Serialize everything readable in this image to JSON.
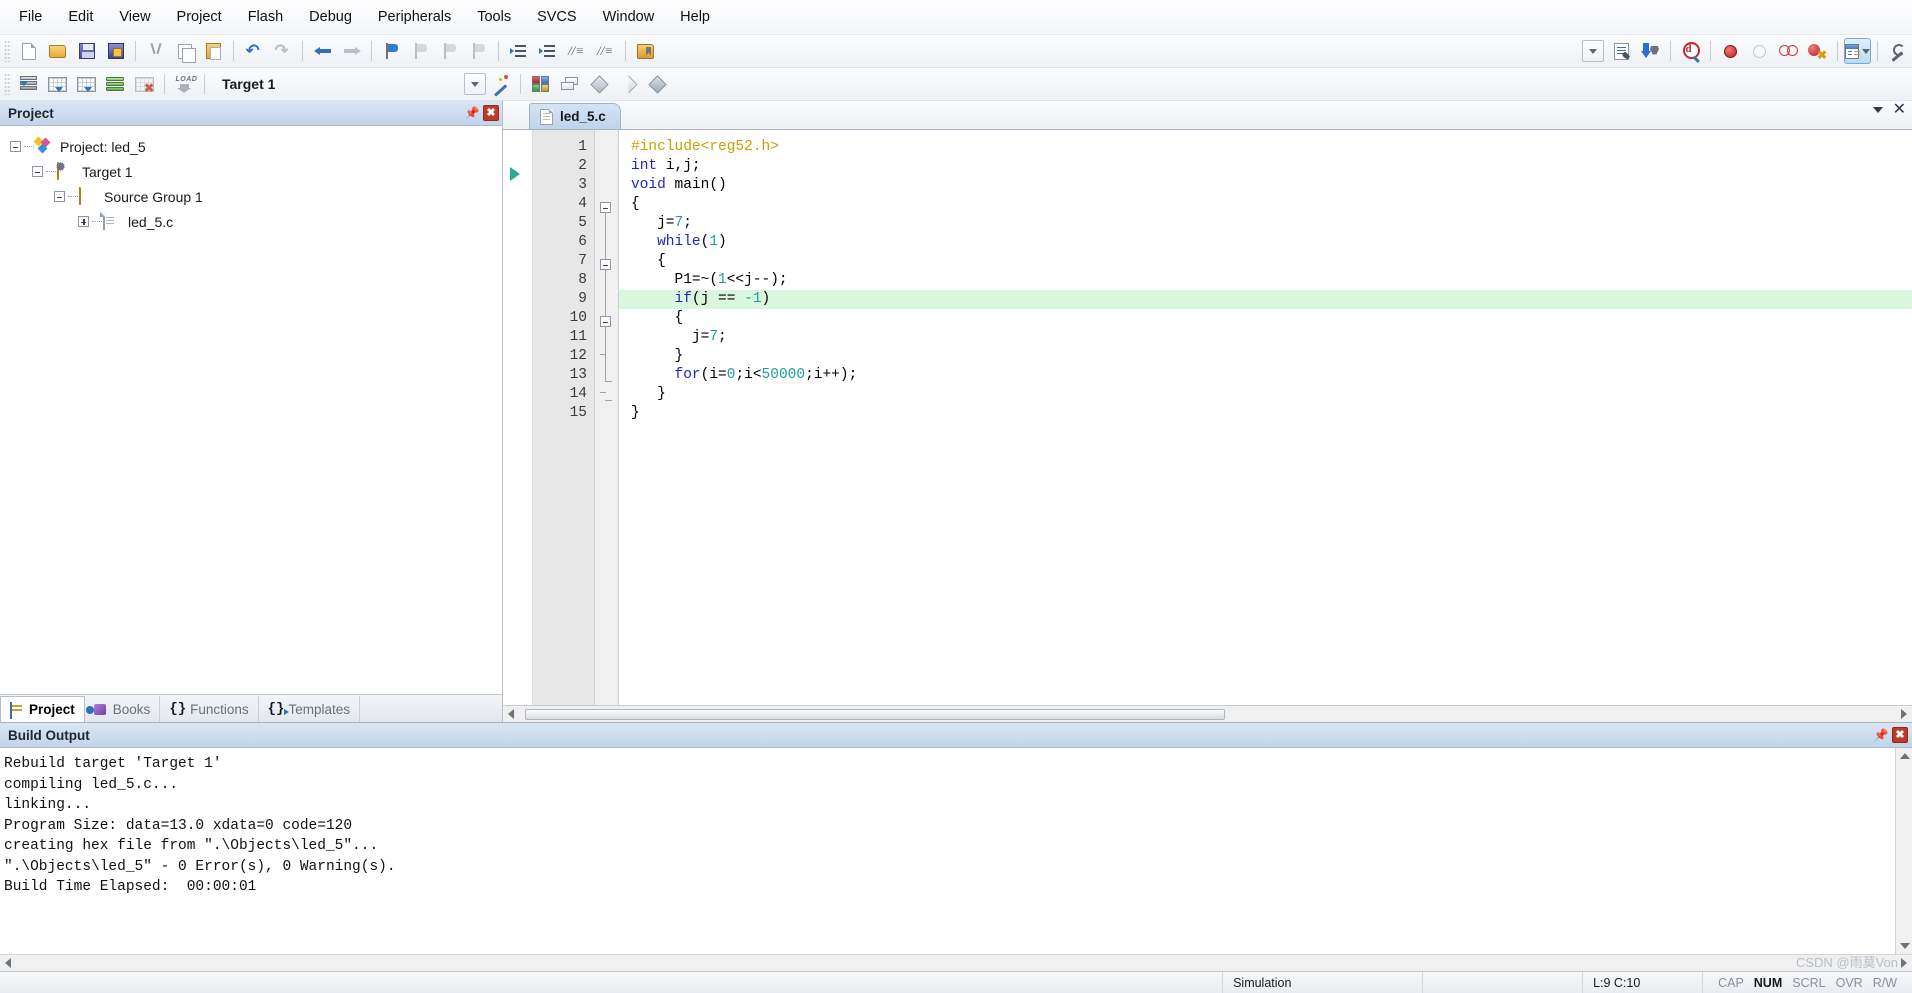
{
  "menubar": {
    "items": [
      {
        "label": "File"
      },
      {
        "label": "Edit"
      },
      {
        "label": "View"
      },
      {
        "label": "Project"
      },
      {
        "label": "Flash"
      },
      {
        "label": "Debug"
      },
      {
        "label": "Peripherals"
      },
      {
        "label": "Tools"
      },
      {
        "label": "SVCS"
      },
      {
        "label": "Window"
      },
      {
        "label": "Help"
      }
    ]
  },
  "toolbar_main": {
    "buttons": [
      {
        "name": "new-file-icon"
      },
      {
        "name": "open-file-icon"
      },
      {
        "name": "save-icon"
      },
      {
        "name": "save-all-icon"
      },
      {
        "name": "cut-icon"
      },
      {
        "name": "copy-icon"
      },
      {
        "name": "paste-icon"
      },
      {
        "name": "undo-icon"
      },
      {
        "name": "redo-icon"
      },
      {
        "name": "navigate-back-icon"
      },
      {
        "name": "navigate-forward-icon"
      },
      {
        "name": "bookmark-toggle-icon"
      },
      {
        "name": "bookmark-prev-icon"
      },
      {
        "name": "bookmark-next-icon"
      },
      {
        "name": "bookmark-clear-icon"
      },
      {
        "name": "indent-right-icon"
      },
      {
        "name": "indent-left-icon"
      },
      {
        "name": "comment-lines-icon"
      },
      {
        "name": "uncomment-lines-icon"
      },
      {
        "name": "open-folder-icon"
      }
    ],
    "right_buttons": [
      {
        "name": "combo-dropdown-icon"
      },
      {
        "name": "configure-debug-icon"
      },
      {
        "name": "download-icon"
      },
      {
        "name": "find-in-files-icon"
      },
      {
        "name": "insert-breakpoint-icon"
      },
      {
        "name": "remove-breakpoint-icon"
      },
      {
        "name": "disable-breakpoint-icon"
      },
      {
        "name": "kill-breakpoints-icon"
      },
      {
        "name": "window-panels-icon"
      },
      {
        "name": "configure-target-icon"
      }
    ]
  },
  "toolbar_build": {
    "buttons": [
      {
        "name": "translate-file-icon"
      },
      {
        "name": "build-target-icon"
      },
      {
        "name": "rebuild-all-icon"
      },
      {
        "name": "batch-build-icon"
      },
      {
        "name": "stop-build-icon"
      },
      {
        "name": "download-flash-icon"
      }
    ],
    "target_value": "Target 1",
    "after_buttons": [
      {
        "name": "target-options-icon"
      },
      {
        "name": "manage-components-icon"
      },
      {
        "name": "multi-project-icon"
      },
      {
        "name": "pack-installer-icon"
      },
      {
        "name": "filter-icon"
      },
      {
        "name": "manage-run-env-icon"
      }
    ]
  },
  "project_panel": {
    "title": "Project",
    "pin_icon": "pin-icon",
    "close_icon": "close-icon",
    "tree": [
      {
        "label": "Project: led_5",
        "depth": 0,
        "expander": "minus",
        "icon": "project-icon"
      },
      {
        "label": "Target 1",
        "depth": 1,
        "expander": "minus",
        "icon": "target-folder-icon"
      },
      {
        "label": "Source Group 1",
        "depth": 2,
        "expander": "minus",
        "icon": "folder-icon"
      },
      {
        "label": "led_5.c",
        "depth": 3,
        "expander": "plus",
        "icon": "c-file-icon"
      }
    ]
  },
  "left_tabs": [
    {
      "label": "Project",
      "selected": true,
      "icon": "project-tab-icon"
    },
    {
      "label": "Books",
      "selected": false,
      "icon": "books-tab-icon"
    },
    {
      "label": "Functions",
      "selected": false,
      "icon": "functions-tab-icon"
    },
    {
      "label": "Templates",
      "selected": false,
      "icon": "templates-tab-icon"
    }
  ],
  "editor": {
    "tab_label": "led_5.c",
    "tab_icon": "c-file-icon",
    "tabbar_dropdown_icon": "chevron-down-icon",
    "tabbar_close_icon": "close-icon",
    "current_line_marker": 2,
    "highlight_line": 9,
    "lines": [
      {
        "n": 1,
        "tokens": [
          {
            "t": "#include<reg52.h>",
            "c": "k-pre"
          }
        ]
      },
      {
        "n": 2,
        "tokens": [
          {
            "t": "int",
            "c": "k-kw"
          },
          {
            "t": " i,j;",
            "c": "k-txt"
          }
        ]
      },
      {
        "n": 3,
        "tokens": [
          {
            "t": "void",
            "c": "k-kw"
          },
          {
            "t": " main()",
            "c": "k-txt"
          }
        ]
      },
      {
        "n": 4,
        "tokens": [
          {
            "t": "{",
            "c": "k-txt"
          }
        ]
      },
      {
        "n": 5,
        "tokens": [
          {
            "t": "   j=",
            "c": "k-txt"
          },
          {
            "t": "7",
            "c": "k-num"
          },
          {
            "t": ";",
            "c": "k-txt"
          }
        ]
      },
      {
        "n": 6,
        "tokens": [
          {
            "t": "   ",
            "c": "k-txt"
          },
          {
            "t": "while",
            "c": "k-kw"
          },
          {
            "t": "(",
            "c": "k-txt"
          },
          {
            "t": "1",
            "c": "k-num"
          },
          {
            "t": ")",
            "c": "k-txt"
          }
        ]
      },
      {
        "n": 7,
        "tokens": [
          {
            "t": "   {",
            "c": "k-txt"
          }
        ]
      },
      {
        "n": 8,
        "tokens": [
          {
            "t": "     P1=~(",
            "c": "k-txt"
          },
          {
            "t": "1",
            "c": "k-num"
          },
          {
            "t": "<<j--);",
            "c": "k-txt"
          }
        ]
      },
      {
        "n": 9,
        "tokens": [
          {
            "t": "     ",
            "c": "k-txt"
          },
          {
            "t": "if",
            "c": "k-kw"
          },
          {
            "t": "(j == ",
            "c": "k-txt"
          },
          {
            "t": "-1",
            "c": "k-num"
          },
          {
            "t": ")",
            "c": "k-txt"
          }
        ]
      },
      {
        "n": 10,
        "tokens": [
          {
            "t": "     {",
            "c": "k-txt"
          }
        ]
      },
      {
        "n": 11,
        "tokens": [
          {
            "t": "       j=",
            "c": "k-txt"
          },
          {
            "t": "7",
            "c": "k-num"
          },
          {
            "t": ";",
            "c": "k-txt"
          }
        ]
      },
      {
        "n": 12,
        "tokens": [
          {
            "t": "     }",
            "c": "k-txt"
          }
        ]
      },
      {
        "n": 13,
        "tokens": [
          {
            "t": "     ",
            "c": "k-txt"
          },
          {
            "t": "for",
            "c": "k-kw"
          },
          {
            "t": "(i=",
            "c": "k-txt"
          },
          {
            "t": "0",
            "c": "k-num"
          },
          {
            "t": ";i<",
            "c": "k-txt"
          },
          {
            "t": "50000",
            "c": "k-num"
          },
          {
            "t": ";i++);",
            "c": "k-txt"
          }
        ]
      },
      {
        "n": 14,
        "tokens": [
          {
            "t": "   }",
            "c": "k-txt"
          }
        ]
      },
      {
        "n": 15,
        "tokens": [
          {
            "t": "}",
            "c": "k-txt"
          }
        ]
      }
    ]
  },
  "build_output": {
    "title": "Build Output",
    "pin_icon": "pin-icon",
    "close_icon": "close-icon",
    "text": "Rebuild target 'Target 1'\ncompiling led_5.c...\nlinking...\nProgram Size: data=13.0 xdata=0 code=120\ncreating hex file from \".\\Objects\\led_5\"...\n\".\\Objects\\led_5\" - 0 Error(s), 0 Warning(s).\nBuild Time Elapsed:  00:00:01"
  },
  "statusbar": {
    "simulation": "Simulation",
    "cursor": "L:9 C:10",
    "indicators": [
      {
        "label": "CAP",
        "on": false
      },
      {
        "label": "NUM",
        "on": true
      },
      {
        "label": "SCRL",
        "on": false
      },
      {
        "label": "OVR",
        "on": false
      },
      {
        "label": "R/W",
        "on": false
      }
    ]
  },
  "watermark": "CSDN @雨莫Von",
  "colors": {
    "panel_title_bg": "#c2d4e9",
    "highlight_line": "#d9f7de",
    "keyword": "#2323c8",
    "number": "#1f9c9c",
    "preprocessor": "#c8a000",
    "marker_arrow": "#2aa79a",
    "close_button": "#c0392b"
  }
}
